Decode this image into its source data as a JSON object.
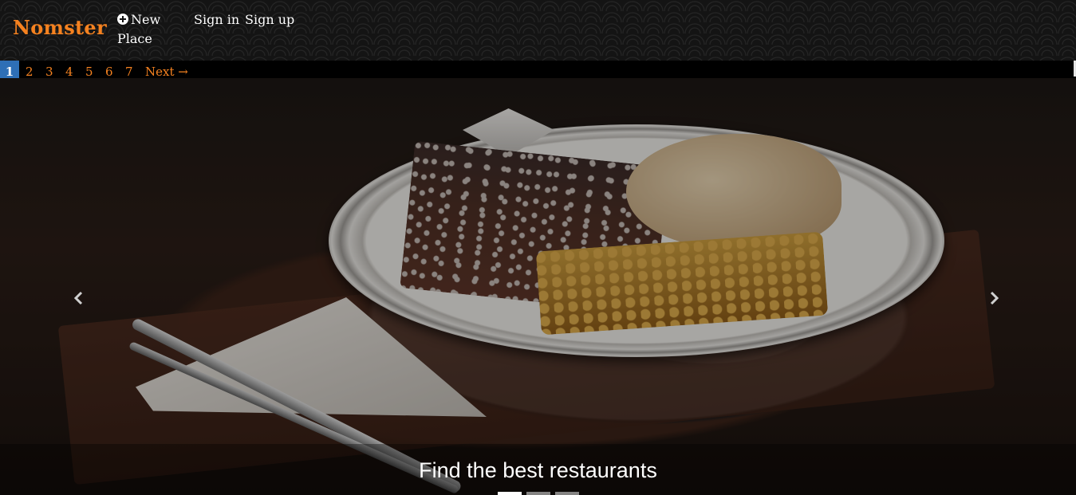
{
  "navbar": {
    "brand": "Nomster",
    "new_place": "New Place",
    "sign_in": "Sign in",
    "sign_up": "Sign up",
    "colors": {
      "brand": "#f58220",
      "background": "#141414"
    },
    "icons": {
      "new_place": "plus-circle-icon"
    }
  },
  "pagination": {
    "pages": [
      "1",
      "2",
      "3",
      "4",
      "5",
      "6",
      "7"
    ],
    "current": "1",
    "next": "Next →",
    "colors": {
      "link": "#f58220",
      "active": "#2e6fb6"
    }
  },
  "carousel": {
    "caption": "Find the best restaurants",
    "slides": 3,
    "active_slide": 1,
    "icons": {
      "prev": "chevron-left-icon",
      "next": "chevron-right-icon"
    }
  }
}
